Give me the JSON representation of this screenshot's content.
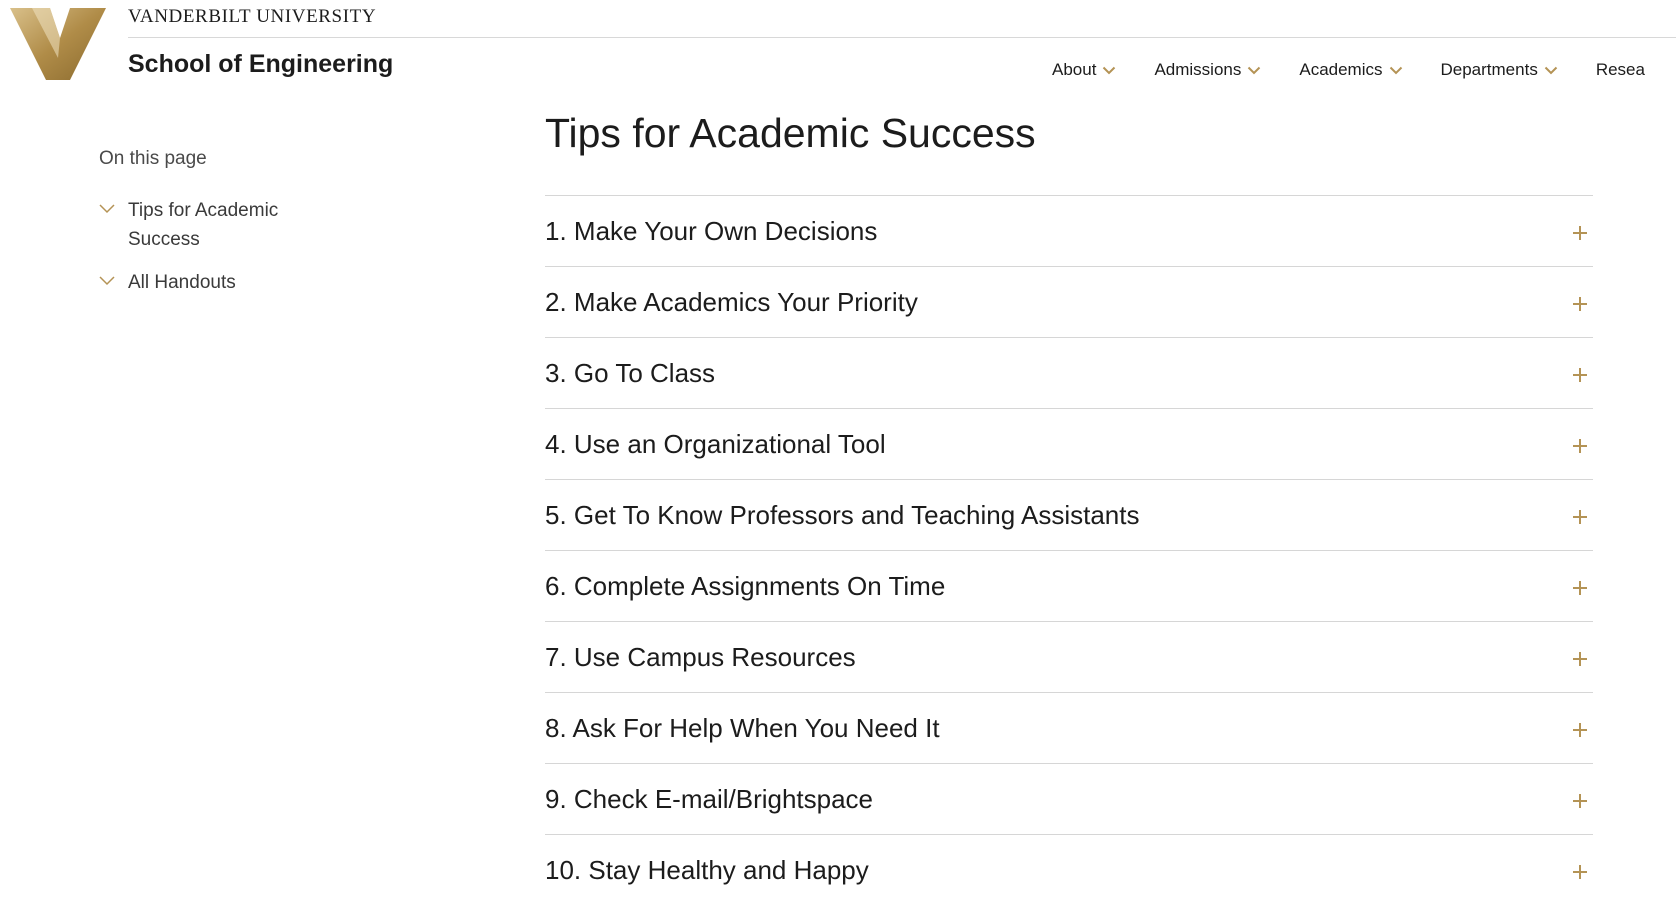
{
  "colors": {
    "gold": "#b49355",
    "text": "#1c1c1c",
    "rule": "#d6d6d6"
  },
  "header": {
    "logo_icon": "vanderbilt-v-logo",
    "university": "VANDERBILT UNIVERSITY",
    "school": "School of Engineering"
  },
  "nav": {
    "items": [
      {
        "label": "About"
      },
      {
        "label": "Admissions"
      },
      {
        "label": "Academics"
      },
      {
        "label": "Departments"
      },
      {
        "label": "Resea"
      }
    ]
  },
  "sidebar": {
    "heading": "On this page",
    "items": [
      {
        "label": "Tips for Academic Success",
        "icon": "chevron-down-icon"
      },
      {
        "label": "All Handouts",
        "icon": "chevron-down-icon"
      }
    ]
  },
  "main": {
    "title": "Tips for Academic Success",
    "accordion": [
      {
        "title": "1. Make Your Own Decisions",
        "icon": "plus-icon"
      },
      {
        "title": "2. Make Academics Your Priority",
        "icon": "plus-icon"
      },
      {
        "title": "3. Go To Class",
        "icon": "plus-icon"
      },
      {
        "title": "4. Use an Organizational Tool",
        "icon": "plus-icon"
      },
      {
        "title": "5. Get To Know Professors and Teaching Assistants",
        "icon": "plus-icon"
      },
      {
        "title": "6. Complete Assignments On Time",
        "icon": "plus-icon"
      },
      {
        "title": "7. Use Campus Resources",
        "icon": "plus-icon"
      },
      {
        "title": "8. Ask For Help When You Need It",
        "icon": "plus-icon"
      },
      {
        "title": "9. Check E-mail/Brightspace",
        "icon": "plus-icon"
      },
      {
        "title": "10. Stay Healthy and Happy",
        "icon": "plus-icon"
      }
    ]
  }
}
